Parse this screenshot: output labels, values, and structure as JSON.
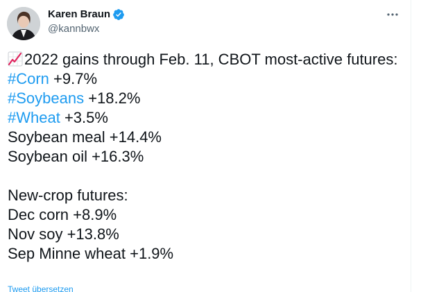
{
  "author": {
    "display_name": "Karen Braun",
    "handle": "@kannbwx",
    "verified": true
  },
  "tweet": {
    "emoji": "chart-increasing-icon",
    "intro": "2022 gains through Feb. 11, CBOT most-active futures:",
    "lines": [
      {
        "hashtag": "#Corn",
        "text": " +9.7%"
      },
      {
        "hashtag": "#Soybeans",
        "text": " +18.2%"
      },
      {
        "hashtag": "#Wheat",
        "text": " +3.5%"
      },
      {
        "hashtag": "",
        "text": "Soybean meal +14.4%"
      },
      {
        "hashtag": "",
        "text": "Soybean oil +16.3%"
      }
    ],
    "new_crop_heading": "New-crop futures:",
    "new_crop_lines": [
      "Dec corn +8.9%",
      "Nov soy +13.8%",
      "Sep Minne wheat +1.9%"
    ]
  },
  "translate_label": "Tweet übersetzen",
  "colors": {
    "link": "#1d9bf0",
    "text": "#0f1419",
    "secondary": "#536471",
    "verified": "#1d9bf0"
  }
}
